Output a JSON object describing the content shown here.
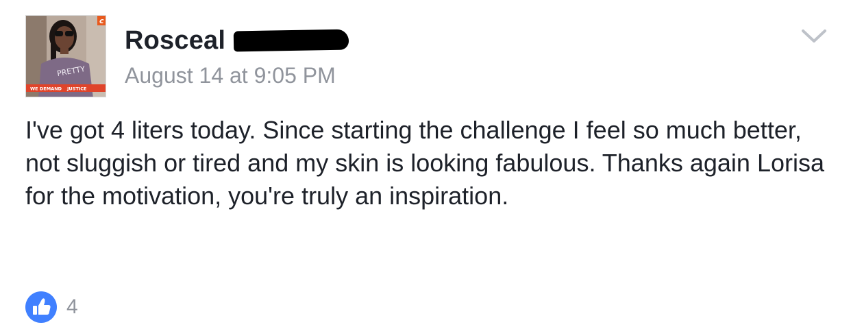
{
  "post": {
    "author_name": "Rosceal",
    "timestamp": "August 14 at 9:05 PM",
    "text": "I've got 4 liters today. Since starting the challenge I feel so much better, not sluggish or tired and my skin is looking fabulous. Thanks again Lorisa for the motivation, you're truly an inspiration.",
    "like_count": "4"
  },
  "avatar": {
    "shirt_text": "PRETTY",
    "banner_text_1": "WE DEMAND",
    "banner_text_2": "JUSTICE",
    "logo_letter": "c"
  },
  "icons": {
    "menu": "chevron-down-icon",
    "like": "thumbs-up-icon"
  },
  "colors": {
    "like_blue": "#4080ff",
    "meta_gray": "#90949c",
    "banner_red": "#e0442a",
    "logo_orange": "#e85a1e"
  }
}
